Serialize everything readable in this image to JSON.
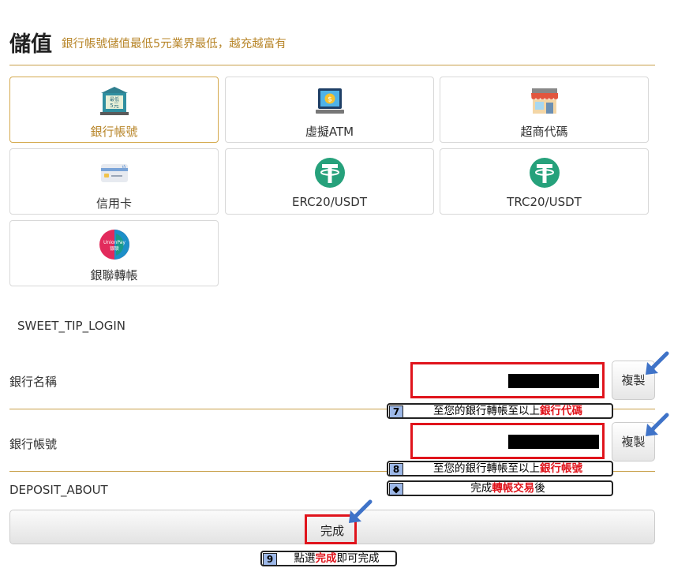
{
  "header": {
    "title": "儲值",
    "subtitle": "銀行帳號儲值最低5元業界最低，越充越富有"
  },
  "methods": [
    {
      "label": "銀行帳號",
      "icon": "bank-icon",
      "active": true
    },
    {
      "label": "虛擬ATM",
      "icon": "atm-icon"
    },
    {
      "label": "超商代碼",
      "icon": "store-icon"
    },
    {
      "label": "信用卡",
      "icon": "credit-card-icon"
    },
    {
      "label": "ERC20/USDT",
      "icon": "tether-icon"
    },
    {
      "label": "TRC20/USDT",
      "icon": "tether-icon"
    },
    {
      "label": "銀聯轉帳",
      "icon": "unionpay-icon"
    }
  ],
  "bank_badge": {
    "line1": "最低",
    "line2": "5元"
  },
  "unionpay_badge": {
    "line1": "UnionPay",
    "line2": "银联"
  },
  "tip": "SWEET_TIP_LOGIN",
  "fields": [
    {
      "label": "銀行名稱",
      "copy_label": "複製"
    },
    {
      "label": "銀行帳號",
      "copy_label": "複製"
    }
  ],
  "about": "DEPOSIT_ABOUT",
  "done_label": "完成",
  "callouts": {
    "c7": {
      "num": "7",
      "pre": "至您的銀行轉帳至以上",
      "hl": "銀行代碼",
      "post": ""
    },
    "c8": {
      "num": "8",
      "pre": "至您的銀行轉帳至以上",
      "hl": "銀行帳號",
      "post": ""
    },
    "cd": {
      "num": "◆",
      "pre": "完成",
      "hl": "轉帳交易",
      "post": "後"
    },
    "c9": {
      "num": "9",
      "pre": "點選",
      "hl": "完成",
      "post": "即可完成"
    }
  },
  "colors": {
    "accent": "#b8862a",
    "highlight_red": "#e0141c",
    "arrow_blue": "#3f73c8",
    "callout_num_bg": "#9db8e8"
  }
}
